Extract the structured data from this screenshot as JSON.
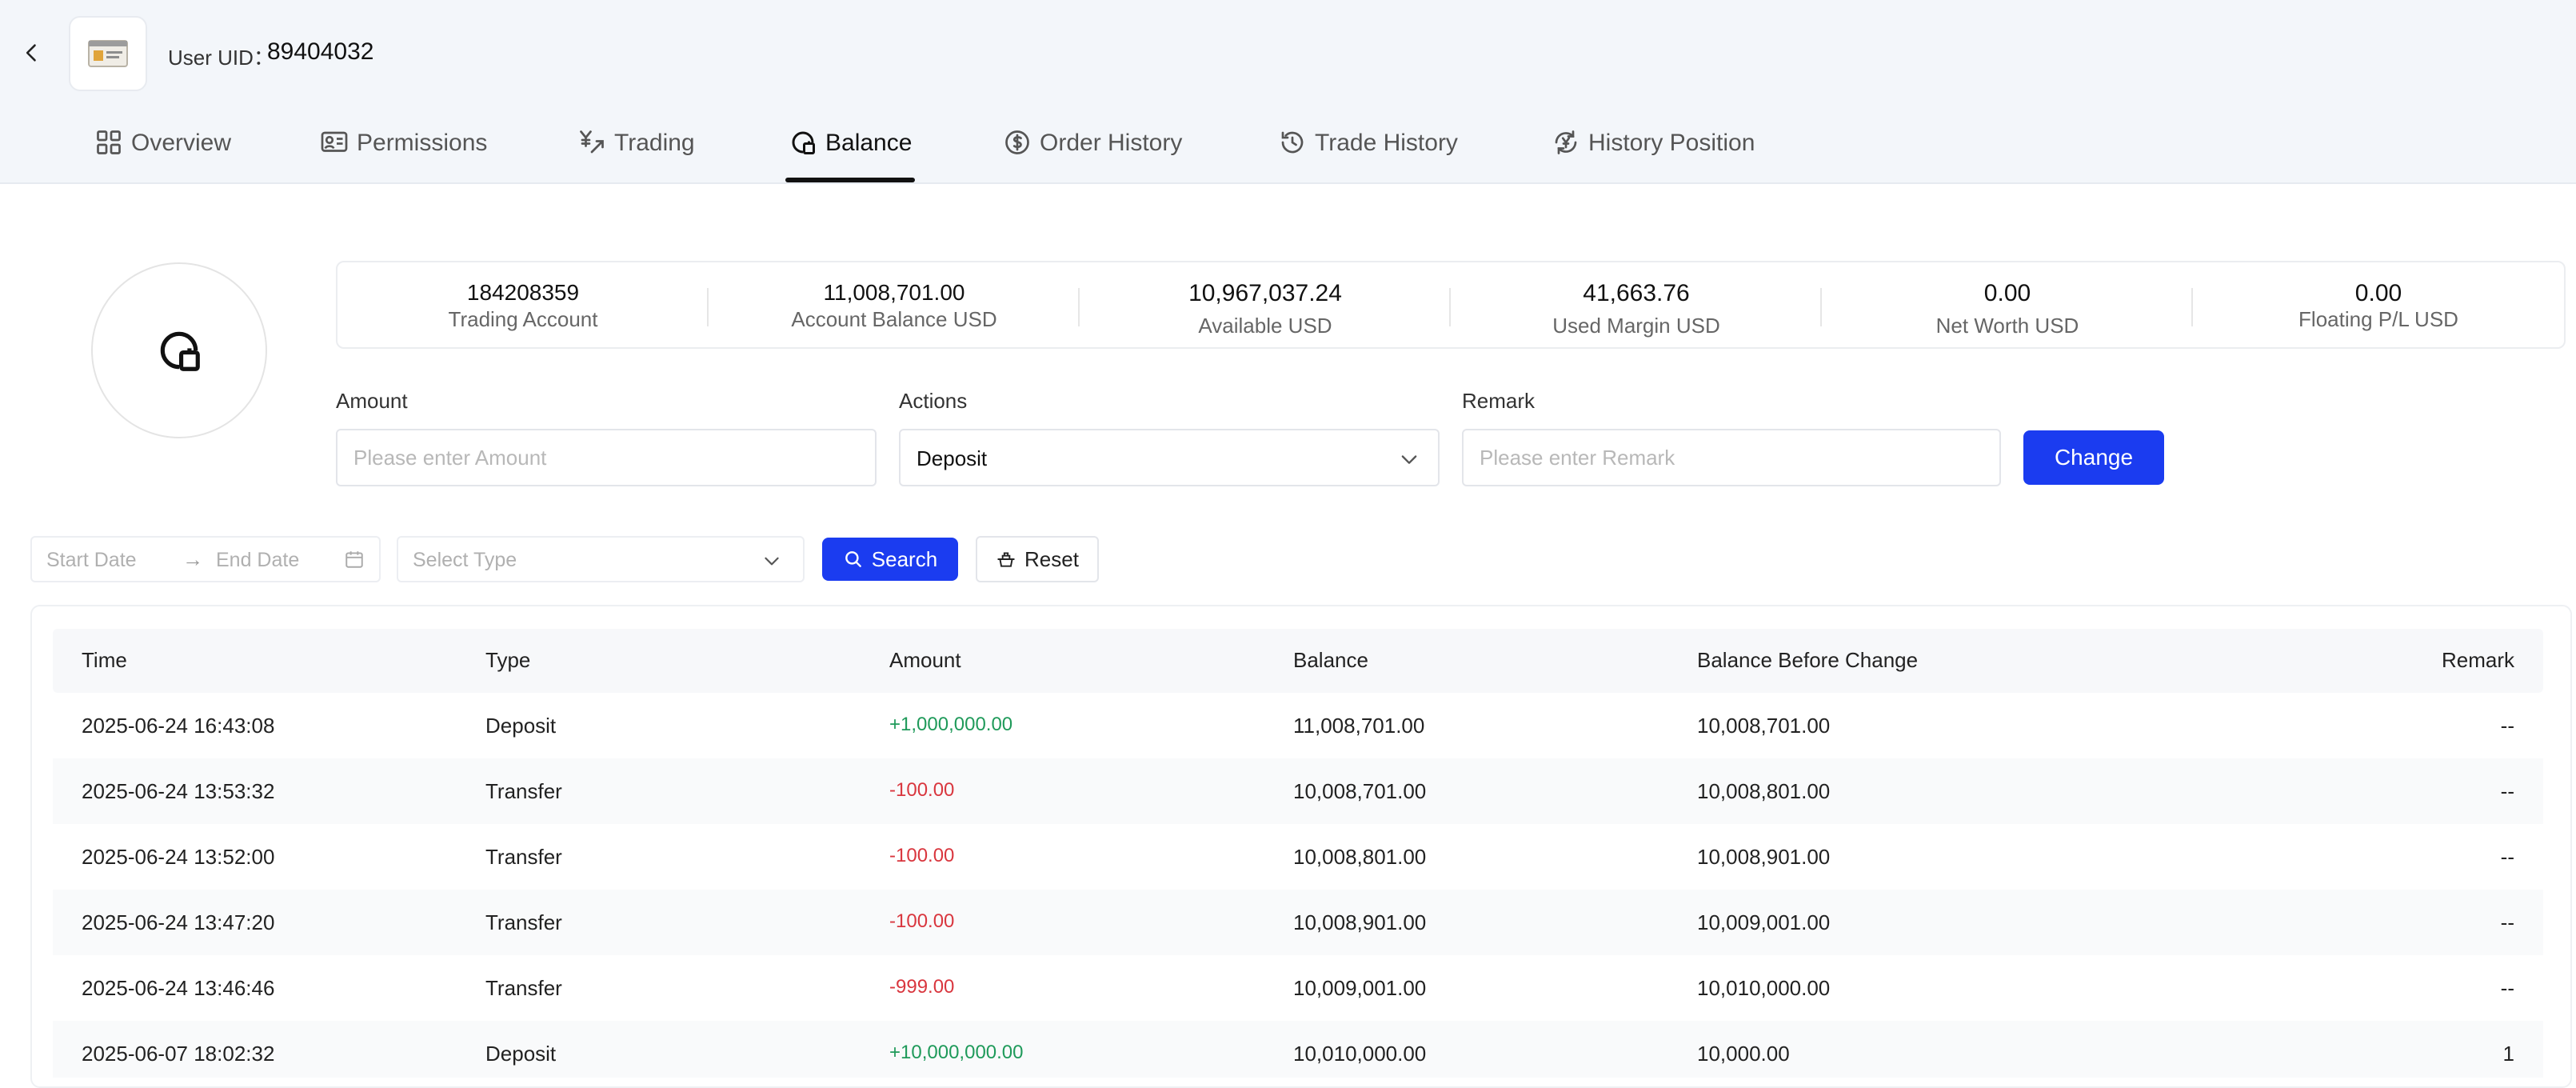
{
  "header": {
    "uid_label": "User UID：",
    "uid_value": "89404032"
  },
  "tabs": [
    {
      "label": "Overview",
      "icon": "grid-icon"
    },
    {
      "label": "Permissions",
      "icon": "id-card-icon"
    },
    {
      "label": "Trading",
      "icon": "trade-icon"
    },
    {
      "label": "Balance",
      "icon": "balance-icon"
    },
    {
      "label": "Order History",
      "icon": "dollar-circle-icon"
    },
    {
      "label": "Trade History",
      "icon": "clock-history-icon"
    },
    {
      "label": "History Position",
      "icon": "refresh-yen-icon"
    }
  ],
  "active_tab": "Balance",
  "stats": [
    {
      "value": "184208359",
      "label": "Trading Account"
    },
    {
      "value": "11,008,701.00",
      "label": "Account Balance USD"
    },
    {
      "value": "10,967,037.24",
      "label": "Available USD"
    },
    {
      "value": "41,663.76",
      "label": "Used Margin USD"
    },
    {
      "value": "0.00",
      "label": "Net Worth USD"
    },
    {
      "value": "0.00",
      "label": "Floating P/L USD"
    }
  ],
  "form": {
    "amount_label": "Amount",
    "amount_placeholder": "Please enter Amount",
    "actions_label": "Actions",
    "actions_value": "Deposit",
    "remark_label": "Remark",
    "remark_placeholder": "Please enter Remark",
    "change_button": "Change"
  },
  "filters": {
    "start_date_placeholder": "Start Date",
    "end_date_placeholder": "End Date",
    "range_arrow": "→",
    "type_placeholder": "Select Type",
    "search_button": "Search",
    "reset_button": "Reset"
  },
  "table": {
    "columns": [
      "Time",
      "Type",
      "Amount",
      "Balance",
      "Balance Before Change",
      "Remark"
    ],
    "rows": [
      {
        "time": "2025-06-24 16:43:08",
        "type": "Deposit",
        "amount": "+1,000,000.00",
        "balance": "11,008,701.00",
        "before": "10,008,701.00",
        "remark": "--"
      },
      {
        "time": "2025-06-24 13:53:32",
        "type": "Transfer",
        "amount": "-100.00",
        "balance": "10,008,701.00",
        "before": "10,008,801.00",
        "remark": "--"
      },
      {
        "time": "2025-06-24 13:52:00",
        "type": "Transfer",
        "amount": "-100.00",
        "balance": "10,008,801.00",
        "before": "10,008,901.00",
        "remark": "--"
      },
      {
        "time": "2025-06-24 13:47:20",
        "type": "Transfer",
        "amount": "-100.00",
        "balance": "10,008,901.00",
        "before": "10,009,001.00",
        "remark": "--"
      },
      {
        "time": "2025-06-24 13:46:46",
        "type": "Transfer",
        "amount": "-999.00",
        "balance": "10,009,001.00",
        "before": "10,010,000.00",
        "remark": "--"
      },
      {
        "time": "2025-06-07 18:02:32",
        "type": "Deposit",
        "amount": "+10,000,000.00",
        "balance": "10,010,000.00",
        "before": "10,000.00",
        "remark": "1"
      }
    ]
  },
  "colors": {
    "primary": "#1b3cf0",
    "positive": "#1f9a5a",
    "negative": "#d9363e",
    "header_bg": "#f3f6fa"
  }
}
